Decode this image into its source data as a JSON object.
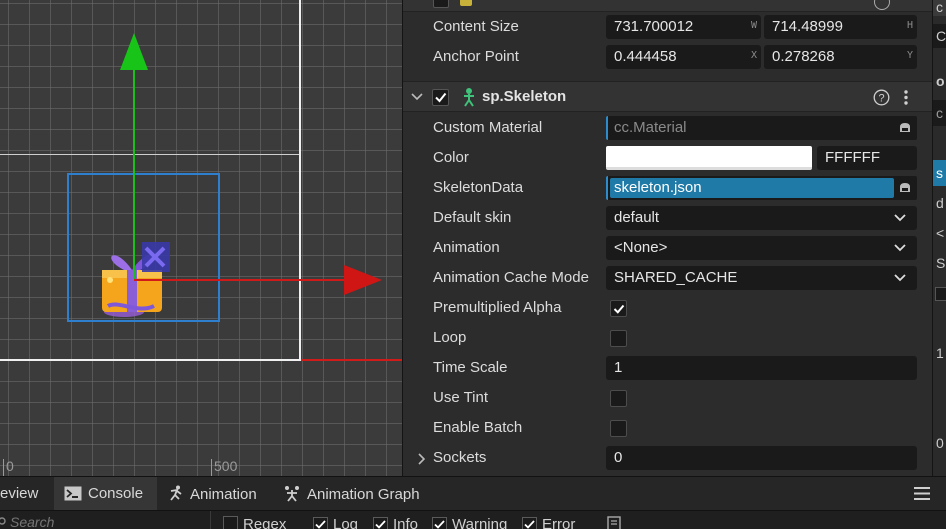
{
  "scene": {
    "ruler_labels": [
      "0",
      "500"
    ]
  },
  "inspector": {
    "content_size": {
      "label": "Content Size",
      "w_value": "731.700012",
      "w_unit": "W",
      "h_value": "714.48999",
      "h_unit": "H"
    },
    "anchor_point": {
      "label": "Anchor Point",
      "x_value": "0.444458",
      "x_unit": "X",
      "y_value": "0.278268",
      "y_unit": "Y"
    },
    "component": {
      "title": "sp.Skeleton",
      "enabled": true,
      "help_icon": "help-circle-icon",
      "menu_icon": "kebab-menu-icon"
    },
    "properties": {
      "custom_material": {
        "label": "Custom Material",
        "value": "cc.Material"
      },
      "color": {
        "label": "Color",
        "hex": "FFFFFF",
        "swatch": "#ffffff"
      },
      "skeleton_data": {
        "label": "SkeletonData",
        "value": "skeleton.json"
      },
      "default_skin": {
        "label": "Default skin",
        "value": "default"
      },
      "animation": {
        "label": "Animation",
        "value": "<None>"
      },
      "animation_cache_mode": {
        "label": "Animation Cache Mode",
        "value": "SHARED_CACHE"
      },
      "premultiplied_alpha": {
        "label": "Premultiplied Alpha",
        "checked": true
      },
      "loop": {
        "label": "Loop",
        "checked": false
      },
      "time_scale": {
        "label": "Time Scale",
        "value": "1"
      },
      "use_tint": {
        "label": "Use Tint",
        "checked": false
      },
      "enable_batch": {
        "label": "Enable Batch",
        "checked": false
      },
      "sockets": {
        "label": "Sockets",
        "value": "0"
      }
    }
  },
  "right_panel": {
    "fragments": [
      "c",
      "C",
      "o",
      "c",
      "s",
      "d",
      "<",
      "S",
      "1",
      "0"
    ]
  },
  "bottom": {
    "tabs": [
      {
        "label": "eview",
        "icon": "",
        "active": false
      },
      {
        "label": "Console",
        "icon": "console-icon",
        "active": true
      },
      {
        "label": "Animation",
        "icon": "running-figure-icon",
        "active": false
      },
      {
        "label": "Animation Graph",
        "icon": "animation-graph-icon",
        "active": false
      }
    ],
    "menu_icon": "hamburger-menu-icon",
    "search_placeholder": "Search",
    "filters": [
      {
        "label": "Regex",
        "checked": false
      },
      {
        "label": "Log",
        "checked": true
      },
      {
        "label": "Info",
        "checked": true
      },
      {
        "label": "Warning",
        "checked": true
      },
      {
        "label": "Error",
        "checked": true
      }
    ]
  },
  "colors": {
    "accent_blue": "#2d8ccc",
    "selected_asset_bg": "#1f7aa8",
    "axis_x": "#d01a1a",
    "axis_y": "#18c418",
    "node_box": "#2f7fcf"
  }
}
